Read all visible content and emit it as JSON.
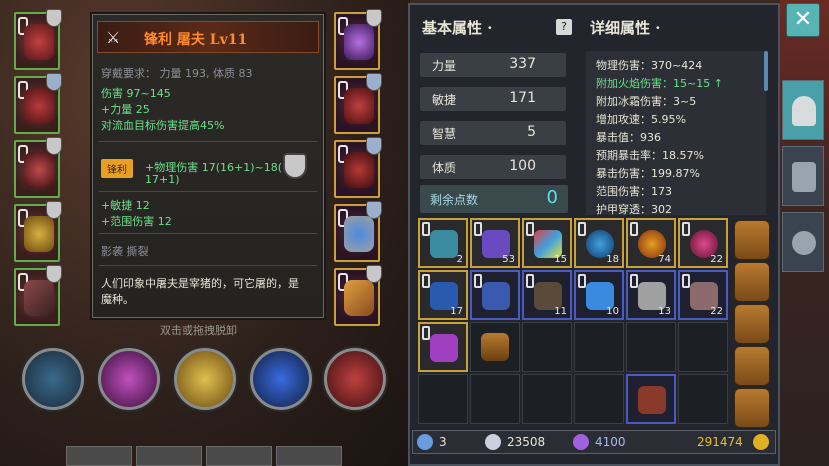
{
  "tooltip": {
    "title": "锋利 屠夫 Lv11",
    "requirement": "穿戴要求：   力量 193, 体质 83",
    "damage": "伤害   97~145",
    "strength_bonus": "+力量 25",
    "bleed_bonus": "对流血目标伤害提高45%",
    "tag": "锋利",
    "physical_bonus_line1": "+物理伤害 17(16+1)~18(",
    "physical_bonus_line2": "17+1)",
    "agility_bonus": "+敏捷  12",
    "aoe_bonus": "+范围伤害  12",
    "skills": "影袭   撕裂",
    "flavor_line1": "人们印象中屠夫是宰猪的，可它屠的，是",
    "flavor_line2": "魔种。",
    "hint": "双击或拖拽脱卸"
  },
  "panel": {
    "basic_title": "基本属性 ·",
    "detail_title": "详细属性 ·",
    "help_label": "?",
    "stats": [
      {
        "key": "力量",
        "value": "337"
      },
      {
        "key": "敏捷",
        "value": "171"
      },
      {
        "key": "智慧",
        "value": "5"
      },
      {
        "key": "体质",
        "value": "100"
      }
    ],
    "remaining_label": "剩余点数",
    "remaining_value": "0",
    "details": [
      {
        "text": "物理伤害：370~424",
        "highlight": false
      },
      {
        "text": "附加火焰伤害：15~15  ↑",
        "highlight": true
      },
      {
        "text": "附加冰霜伤害：3~5",
        "highlight": false
      },
      {
        "text": "增加攻速：5.95%",
        "highlight": false
      },
      {
        "text": "暴击值：936",
        "highlight": false
      },
      {
        "text": "预期暴击率：18.57%",
        "highlight": false
      },
      {
        "text": "暴击伤害：199.87%",
        "highlight": false
      },
      {
        "text": "范围伤害：173",
        "highlight": false
      },
      {
        "text": "护甲穿透：302",
        "highlight": false
      }
    ]
  },
  "inventory": {
    "counts": [
      "2",
      "53",
      "15",
      "18",
      "74",
      "22",
      "17",
      "",
      "11",
      "10",
      "13",
      "22"
    ]
  },
  "bottom_bar": {
    "keys": "3",
    "silver": "23508",
    "crystals": "4100",
    "gold": "291474"
  },
  "close_label": "✕",
  "colors": {
    "accent_teal": "#58b4b4",
    "item_gold_border": "#c9a03a",
    "equip_green_border": "#5fae4a",
    "bonus_green": "#6ce08a",
    "title_orange": "#ff8a2a"
  }
}
